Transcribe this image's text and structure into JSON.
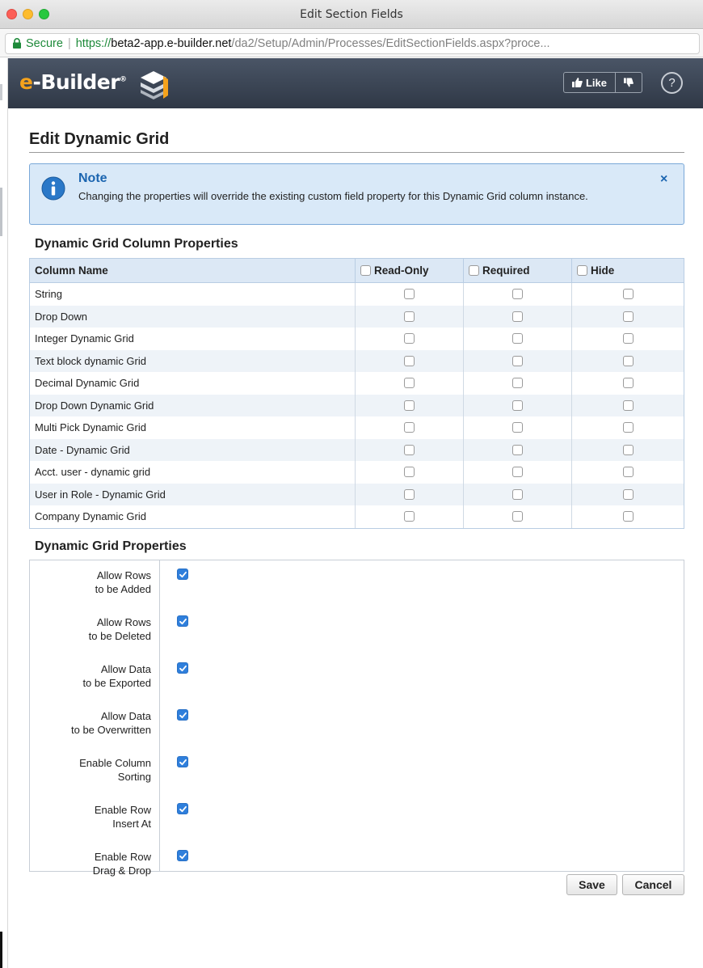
{
  "window": {
    "title": "Edit Section Fields"
  },
  "address": {
    "secure_label": "Secure",
    "scheme": "https://",
    "host": "beta2-app.e-builder.net",
    "path": "/da2/Setup/Admin/Processes/EditSectionFields.aspx?proce..."
  },
  "header": {
    "logo_e": "e",
    "logo_text": "-Builder",
    "logo_reg": "®",
    "like_label": "Like",
    "help_label": "?"
  },
  "page": {
    "title": "Edit Dynamic Grid"
  },
  "note": {
    "title": "Note",
    "text": "Changing the properties will override the existing custom field property for this Dynamic Grid column instance.",
    "close": "×"
  },
  "column_props": {
    "heading": "Dynamic Grid Column Properties",
    "headers": {
      "name": "Column Name",
      "readonly": "Read-Only",
      "required": "Required",
      "hide": "Hide"
    },
    "rows": [
      "String",
      "Drop Down",
      "Integer Dynamic Grid",
      "Text block dynamic Grid",
      "Decimal Dynamic Grid",
      "Drop Down Dynamic Grid",
      "Multi Pick Dynamic Grid",
      "Date - Dynamic Grid",
      "Acct. user - dynamic grid",
      "User in Role - Dynamic Grid",
      "Company Dynamic Grid"
    ]
  },
  "grid_props": {
    "heading": "Dynamic Grid Properties",
    "items": [
      {
        "line1": "Allow Rows",
        "line2": "to be Added",
        "checked": true
      },
      {
        "line1": "Allow Rows",
        "line2": "to be Deleted",
        "checked": true
      },
      {
        "line1": "Allow Data",
        "line2": "to be Exported",
        "checked": true
      },
      {
        "line1": "Allow Data",
        "line2": "to be Overwritten",
        "checked": true
      },
      {
        "line1": "Enable Column",
        "line2": "Sorting",
        "checked": true
      },
      {
        "line1": "Enable Row",
        "line2": "Insert At",
        "checked": true
      },
      {
        "line1": "Enable Row",
        "line2": "Drag & Drop",
        "checked": true
      }
    ]
  },
  "actions": {
    "save": "Save",
    "cancel": "Cancel"
  }
}
